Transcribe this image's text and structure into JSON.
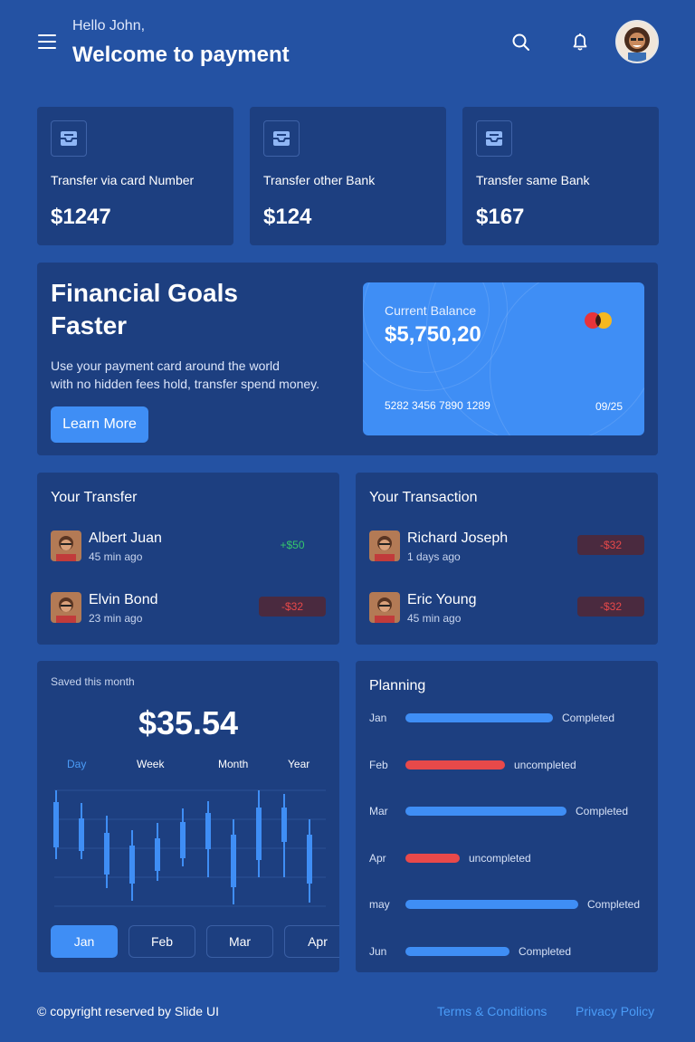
{
  "header": {
    "greeting": "Hello John,",
    "title": "Welcome to payment",
    "icons": {
      "menu": "menu-icon",
      "search": "search-icon",
      "notification": "bell-icon"
    }
  },
  "transfer_cards": [
    {
      "label": "Transfer via card Number",
      "amount": "$1247",
      "icon": "inbox-icon"
    },
    {
      "label": "Transfer other Bank",
      "amount": "$124",
      "icon": "inbox-icon"
    },
    {
      "label": "Transfer same Bank",
      "amount": "$167",
      "icon": "inbox-icon"
    }
  ],
  "goals": {
    "title_line1": "Financial Goals",
    "title_line2": "Faster",
    "desc_line1": "Use your payment card around the world",
    "desc_line2": "with no hidden fees hold, transfer spend money.",
    "button": "Learn More"
  },
  "card": {
    "label": "Current Balance",
    "balance": "$5,750,20",
    "number": "5282 3456 7890 1289",
    "expiry": "09/25"
  },
  "your_transfer": {
    "title": "Your Transfer",
    "rows": [
      {
        "name": "Albert Juan",
        "time": "45 min ago",
        "amount": "+$50"
      },
      {
        "name": "Elvin Bond",
        "time": "23 min ago",
        "amount": "-$32"
      }
    ]
  },
  "your_transaction": {
    "title": "Your Transaction",
    "rows": [
      {
        "name": "Richard Joseph",
        "time": "1 days ago",
        "amount": "-$32"
      },
      {
        "name": "Eric Young",
        "time": "45 min ago",
        "amount": "-$32"
      }
    ]
  },
  "saved": {
    "label": "Saved this month",
    "amount": "$35.54",
    "periods": [
      "Day",
      "Week",
      "Month",
      "Year"
    ],
    "active_period": "Day",
    "months": [
      "Jan",
      "Feb",
      "Mar",
      "Apr"
    ],
    "active_month": "Jan"
  },
  "planning": {
    "title": "Planning",
    "items": [
      {
        "month": "Jan",
        "status": "Completed",
        "progress": 0.62
      },
      {
        "month": "Feb",
        "status": "uncompleted",
        "progress": 0.42
      },
      {
        "month": "Mar",
        "status": "Completed",
        "progress": 0.68
      },
      {
        "month": "Apr",
        "status": "uncompleted",
        "progress": 0.23
      },
      {
        "month": "may",
        "status": "Completed",
        "progress": 0.73
      },
      {
        "month": "Jun",
        "status": "Completed",
        "progress": 0.44
      }
    ]
  },
  "footer": {
    "copyright": "© copyright reserved by Slide UI",
    "terms": "Terms & Conditions",
    "privacy": "Privacy Policy"
  },
  "colors": {
    "background": "#2452a3",
    "card": "#1d3f80",
    "accent": "#3f8ef5",
    "completed": "#3f8ef5",
    "uncompleted": "#e8494a",
    "positive": "#35c76c",
    "negative": "#e8494a"
  }
}
